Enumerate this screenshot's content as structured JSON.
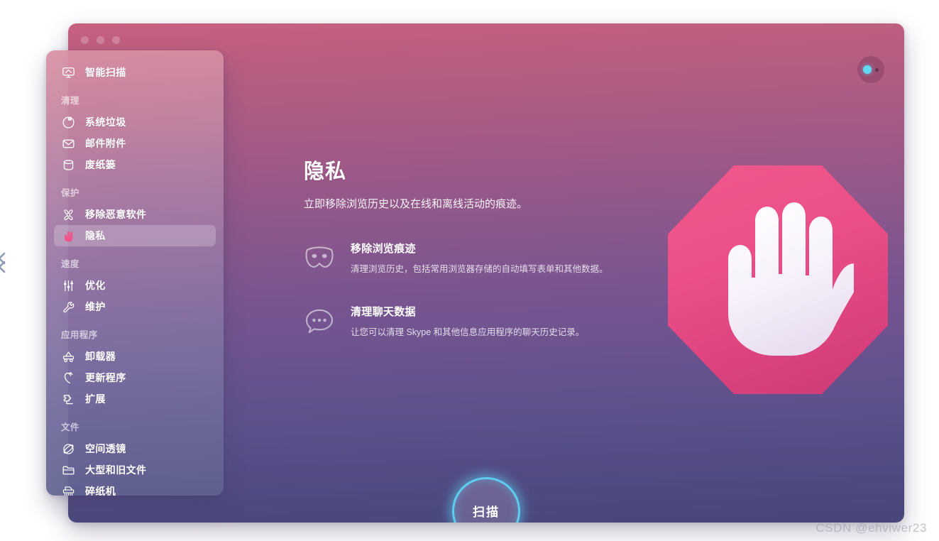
{
  "window": {
    "traffic_lights": [
      "close",
      "minimize",
      "zoom"
    ],
    "status_button": "status-indicator"
  },
  "sidebar": {
    "entries": [
      {
        "kind": "item",
        "icon": "monitor-scan-icon",
        "label": "智能扫描",
        "selected": false
      },
      {
        "kind": "group",
        "label": "清理"
      },
      {
        "kind": "item",
        "icon": "system-junk-icon",
        "label": "系统垃圾",
        "selected": false
      },
      {
        "kind": "item",
        "icon": "mail-envelope-icon",
        "label": "邮件附件",
        "selected": false
      },
      {
        "kind": "item",
        "icon": "trash-bin-icon",
        "label": "废纸篓",
        "selected": false
      },
      {
        "kind": "group",
        "label": "保护"
      },
      {
        "kind": "item",
        "icon": "biohazard-icon",
        "label": "移除恶意软件",
        "selected": false
      },
      {
        "kind": "item",
        "icon": "stop-hand-icon",
        "label": "隐私",
        "selected": true
      },
      {
        "kind": "group",
        "label": "速度"
      },
      {
        "kind": "item",
        "icon": "sliders-icon",
        "label": "优化",
        "selected": false
      },
      {
        "kind": "item",
        "icon": "wrench-icon",
        "label": "维护",
        "selected": false
      },
      {
        "kind": "group",
        "label": "应用程序"
      },
      {
        "kind": "item",
        "icon": "uninstaller-icon",
        "label": "卸载器",
        "selected": false
      },
      {
        "kind": "item",
        "icon": "updater-arrow-icon",
        "label": "更新程序",
        "selected": false
      },
      {
        "kind": "item",
        "icon": "puzzle-piece-icon",
        "label": "扩展",
        "selected": false
      },
      {
        "kind": "group",
        "label": "文件"
      },
      {
        "kind": "item",
        "icon": "space-lens-icon",
        "label": "空间透镜",
        "selected": false
      },
      {
        "kind": "item",
        "icon": "folder-icon",
        "label": "大型和旧文件",
        "selected": false
      },
      {
        "kind": "item",
        "icon": "shredder-icon",
        "label": "碎纸机",
        "selected": false
      }
    ]
  },
  "main": {
    "title": "隐私",
    "subtitle": "立即移除浏览历史以及在线和离线活动的痕迹。",
    "features": [
      {
        "icon": "mask-icon",
        "title": "移除浏览痕迹",
        "desc": "清理浏览历史，包括常用浏览器存储的自动填写表单和其他数据。"
      },
      {
        "icon": "chat-bubble-icon",
        "title": "清理聊天数据",
        "desc": "让您可以清理 Skype 和其他信息应用程序的聊天历史记录。"
      }
    ],
    "hero_icon": "stop-sign-hand-illustration",
    "scan_button": "扫描"
  },
  "watermark": "CSDN @ehviwer23",
  "colors": {
    "window_gradient_top": "#c7607f",
    "window_gradient_bottom": "#474579",
    "accent_cyan": "#5ecdf0",
    "octagon_pink": "#ec4f88",
    "selected_item_bg": "rgba(255,255,255,.22)"
  }
}
